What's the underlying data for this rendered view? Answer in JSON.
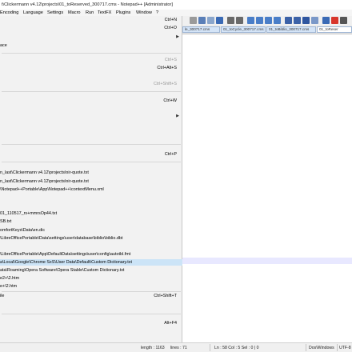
{
  "window": {
    "title": "t\\Clickermann v4.12\\projects\\01_toReserved_300717.cms - Notepad++ [Administrator]"
  },
  "menubar": [
    "Encoding",
    "Language",
    "Settings",
    "Macro",
    "Run",
    "TextFX",
    "Plugins",
    "Window",
    "?"
  ],
  "tabs": [
    "le_300717.cms",
    "01_toCycle_300717.cms",
    "01_toBiblio_300717.cms",
    "01_toReser"
  ],
  "file_menu": {
    "items": [
      {
        "label": "",
        "shortcut": "Ctrl+N"
      },
      {
        "label": "",
        "shortcut": "Ctrl+O"
      },
      {
        "label": "",
        "shortcut": ""
      },
      {
        "label": "ace",
        "shortcut": ""
      },
      {
        "label": "",
        "shortcut": "Ctrl+S"
      },
      {
        "label": "",
        "shortcut": "Ctrl+Alt+S"
      },
      {
        "label": "",
        "shortcut": "Ctrl+Shift+S"
      },
      {
        "label": "",
        "shortcut": "Ctrl+W"
      },
      {
        "label": "",
        "shortcut": "Ctrl+P"
      },
      {
        "label": "n_last\\Clickermann v4.12\\projects\\nir-quote.txt",
        "shortcut": ""
      },
      {
        "label": "n_last\\Clickermann v4.12\\projects\\nir-quote.txt",
        "shortcut": ""
      },
      {
        "label": "\\Notepad++Portable\\App\\Notepad++\\contextMenu.xml",
        "shortcut": ""
      },
      {
        "label": "01_110517_rs+mmrsOp44.txt",
        "shortcut": ""
      },
      {
        "label": "SB.txt",
        "shortcut": ""
      },
      {
        "label": "omfortKeys\\Data\\en.dic",
        "shortcut": ""
      },
      {
        "label": "\\LibreOfficePortable\\Data\\settings\\user\\database\\biblio\\biblio.dbt",
        "shortcut": ""
      },
      {
        "label": "\\LibreOfficePortable\\App\\DefaultData\\settings\\user\\config\\autotbl.fmt",
        "shortcut": ""
      },
      {
        "label": "a\\Local\\Google\\Chrome SxS\\User Data\\Default\\Custom Dictionary.txt",
        "shortcut": ""
      },
      {
        "label": "ata\\Roaming\\Opera Software\\Opera Stable\\Custom Dictionary.txt",
        "shortcut": ""
      },
      {
        "label": "e2+\\2.htm",
        "shortcut": ""
      },
      {
        "label": "e+\\2.htm",
        "shortcut": ""
      },
      {
        "label": "ile",
        "shortcut": "Ctrl+Shift+T"
      },
      {
        "label": "",
        "shortcut": "Alt+F4"
      }
    ]
  },
  "statusbar": {
    "length": "length : 1163",
    "lines": "lines : 71",
    "position": "Ln : 58    Col : 5    Sel : 0 | 0",
    "eol": "Dos\\Windows",
    "encoding": "UTF-8"
  },
  "colors": {
    "highlight": "#cce4f7",
    "tab_active": "#d4e4f7",
    "accent_red": "#d8362b"
  }
}
